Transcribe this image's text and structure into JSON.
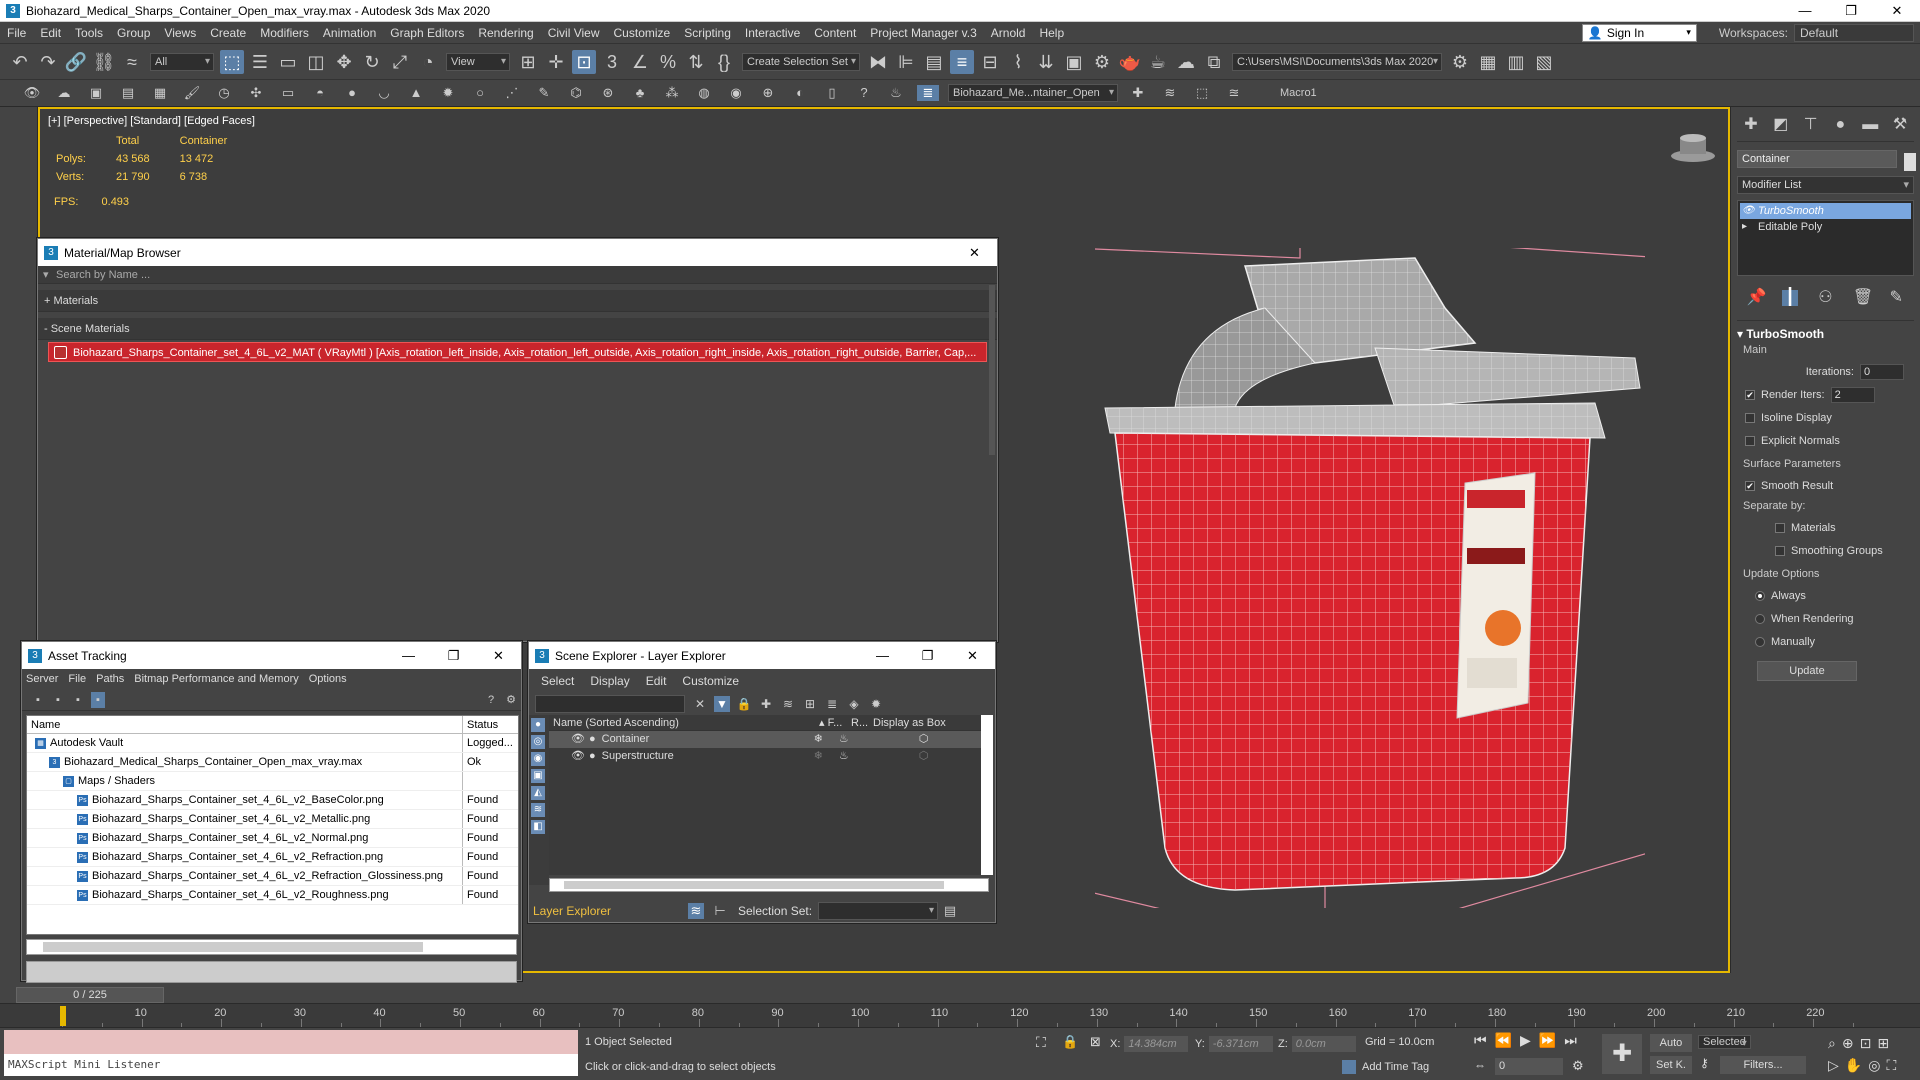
{
  "window": {
    "title": "Biohazard_Medical_Sharps_Container_Open_max_vray.max - Autodesk 3ds Max 2020",
    "app_icon": "3",
    "controls": [
      "—",
      "❐",
      "✕"
    ]
  },
  "menu": [
    "File",
    "Edit",
    "Tools",
    "Group",
    "Views",
    "Create",
    "Modifiers",
    "Animation",
    "Graph Editors",
    "Rendering",
    "Civil View",
    "Customize",
    "Scripting",
    "Interactive",
    "Content",
    "Project Manager v.3",
    "Arnold",
    "Help"
  ],
  "signin": {
    "label": "Sign In",
    "workspaces_label": "Workspaces:",
    "workspace": "Default"
  },
  "toolbar": {
    "filter": "All",
    "refcoord": "View",
    "selection_set": "Create Selection Set",
    "path": "C:\\Users\\MSI\\Documents\\3ds Max 2020",
    "layer_drop": "Biohazard_Me...ntainer_Open",
    "macro": "Macro1"
  },
  "viewport": {
    "label": "[+] [Perspective] [Standard] [Edged Faces]",
    "stats_hdr_total": "Total",
    "stats_hdr_container": "Container",
    "polys_label": "Polys:",
    "polys_total": "43 568",
    "polys_container": "13 472",
    "verts_label": "Verts:",
    "verts_total": "21 790",
    "verts_container": "6 738",
    "fps_label": "FPS:",
    "fps": "0.493",
    "colors": {
      "container": "#d9232e",
      "lid": "#a9a9a9",
      "bbox": "#e08aa0",
      "label": "#f2ede4"
    }
  },
  "command_panel": {
    "object_name": "Container",
    "modifier_list": "Modifier List",
    "stack": [
      "TurboSmooth",
      "Editable Poly"
    ],
    "rollout": {
      "title": "TurboSmooth",
      "main": "Main",
      "iterations_label": "Iterations:",
      "iterations": "0",
      "render_iters_label": "Render Iters:",
      "render_iters": "2",
      "isoline": "Isoline Display",
      "explicit": "Explicit Normals",
      "surface": "Surface Parameters",
      "smooth": "Smooth Result",
      "separate": "Separate by:",
      "materials": "Materials",
      "smoothing": "Smoothing Groups",
      "update_opts": "Update Options",
      "always": "Always",
      "when_render": "When Rendering",
      "manually": "Manually",
      "update_btn": "Update"
    }
  },
  "mmb": {
    "title": "Material/Map Browser",
    "search": "Search by Name ...",
    "materials": "+ Materials",
    "scene_materials": "- Scene Materials",
    "row": "Biohazard_Sharps_Container_set_4_6L_v2_MAT  ( VRayMtl )  [Axis_rotation_left_inside, Axis_rotation_left_outside, Axis_rotation_right_inside, Axis_rotation_right_outside, Barrier, Cap,..."
  },
  "asset": {
    "title": "Asset Tracking",
    "menu": [
      "Server",
      "File",
      "Paths",
      "Bitmap Performance and Memory",
      "Options"
    ],
    "col_name": "Name",
    "col_status": "Status",
    "rows": [
      {
        "name": "Autodesk Vault",
        "status": "Logged...",
        "indent": 0
      },
      {
        "name": "Biohazard_Medical_Sharps_Container_Open_max_vray.max",
        "status": "Ok",
        "indent": 1
      },
      {
        "name": "Maps / Shaders",
        "status": "",
        "indent": 2
      },
      {
        "name": "Biohazard_Sharps_Container_set_4_6L_v2_BaseColor.png",
        "status": "Found",
        "indent": 3
      },
      {
        "name": "Biohazard_Sharps_Container_set_4_6L_v2_Metallic.png",
        "status": "Found",
        "indent": 3
      },
      {
        "name": "Biohazard_Sharps_Container_set_4_6L_v2_Normal.png",
        "status": "Found",
        "indent": 3
      },
      {
        "name": "Biohazard_Sharps_Container_set_4_6L_v2_Refraction.png",
        "status": "Found",
        "indent": 3
      },
      {
        "name": "Biohazard_Sharps_Container_set_4_6L_v2_Refraction_Glossiness.png",
        "status": "Found",
        "indent": 3
      },
      {
        "name": "Biohazard_Sharps_Container_set_4_6L_v2_Roughness.png",
        "status": "Found",
        "indent": 3
      }
    ]
  },
  "scene": {
    "title": "Scene Explorer - Layer Explorer",
    "menu": [
      "Select",
      "Display",
      "Edit",
      "Customize"
    ],
    "col_name": "Name (Sorted Ascending)",
    "col_f": "▴ F...",
    "col_r": "R...",
    "col_box": "Display as Box",
    "layers": [
      "Container",
      "Superstructure"
    ],
    "explorer": "Layer Explorer",
    "selset_label": "Selection Set:"
  },
  "timeline": {
    "frame": "0 / 225",
    "ticks": [
      "10",
      "20",
      "30",
      "40",
      "50",
      "60",
      "70",
      "80",
      "90",
      "100",
      "110",
      "120",
      "130",
      "140",
      "150",
      "160",
      "170",
      "180",
      "190",
      "200",
      "210",
      "220"
    ]
  },
  "status": {
    "maxscript": "MAXScript Mini Listener",
    "selected": "1 Object Selected",
    "hint": "Click or click-and-drag to select objects",
    "x_label": "X:",
    "x": "14.384cm",
    "y_label": "Y:",
    "y": "-6.371cm",
    "z_label": "Z:",
    "z": "0.0cm",
    "grid": "Grid = 10.0cm",
    "add_time_tag": "Add Time Tag",
    "auto": "Auto",
    "setk": "Set K.",
    "selected_drop": "Selected",
    "filters": "Filters...",
    "frame_val": "0"
  }
}
